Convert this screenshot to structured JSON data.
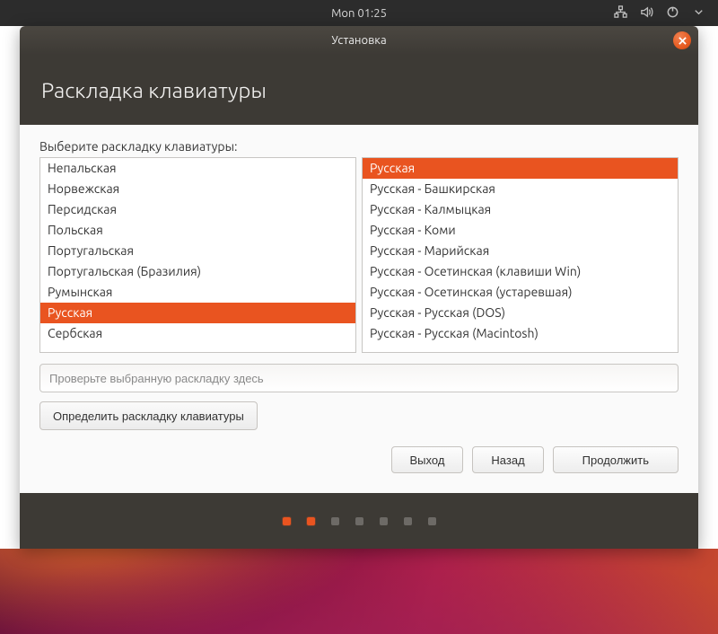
{
  "colors": {
    "accent": "#e95420"
  },
  "topbar": {
    "clock": "Mon 01:25"
  },
  "window": {
    "title": "Установка",
    "header": "Раскладка клавиатуры",
    "prompt": "Выберите раскладку клавиатуры:",
    "left_list": {
      "selected_index": 7,
      "items": [
        "Непальская",
        "Норвежская",
        "Персидская",
        "Польская",
        "Португальская",
        "Португальская (Бразилия)",
        "Румынская",
        "Русская",
        "Сербская"
      ]
    },
    "right_list": {
      "selected_index": 0,
      "items": [
        "Русская",
        "Русская - Башкирская",
        "Русская - Калмыцкая",
        "Русская - Коми",
        "Русская - Марийская",
        "Русская - Осетинская (клавиши Win)",
        "Русская - Осетинская (устаревшая)",
        "Русская - Русская (DOS)",
        "Русская - Русская (Macintosh)"
      ]
    },
    "test_placeholder": "Проверьте выбранную раскладку здесь",
    "detect_label": "Определить раскладку клавиатуры",
    "buttons": {
      "quit": "Выход",
      "back": "Назад",
      "continue": "Продолжить"
    }
  },
  "progress": {
    "total": 7,
    "current": 2
  }
}
